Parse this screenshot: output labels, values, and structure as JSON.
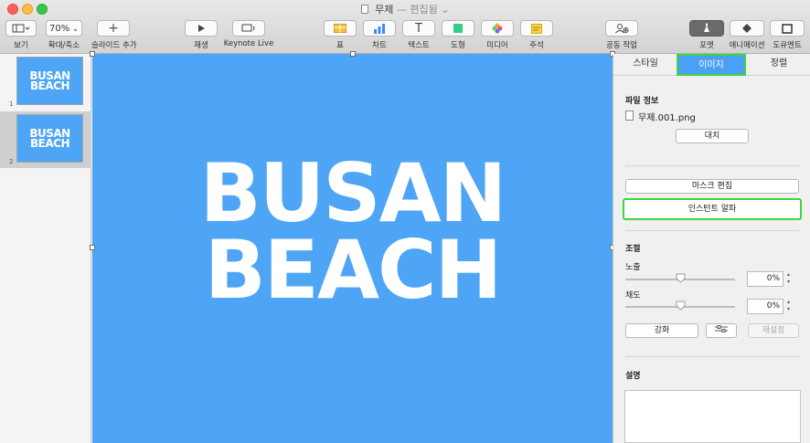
{
  "window": {
    "title": "무제",
    "separator": "—",
    "status": "편집됨"
  },
  "toolbar": {
    "view": {
      "label": "보기"
    },
    "zoom": {
      "value": "70%",
      "label": "확대/축소"
    },
    "add_slide": {
      "label": "슬라이드 추가"
    },
    "play": {
      "label": "재생"
    },
    "keynote_live": {
      "label": "Keynote Live"
    },
    "table": {
      "label": "표"
    },
    "chart": {
      "label": "차트"
    },
    "text": {
      "label": "텍스트"
    },
    "shape": {
      "label": "도형"
    },
    "media": {
      "label": "미디어"
    },
    "comment": {
      "label": "주석"
    },
    "collaborate": {
      "label": "공동 작업"
    },
    "format": {
      "label": "포맷"
    },
    "animate": {
      "label": "애니메이션"
    },
    "document": {
      "label": "도큐멘트"
    }
  },
  "navigator": {
    "slides": [
      {
        "number": "1",
        "line1": "BUSAN",
        "line2": "BEACH"
      },
      {
        "number": "2",
        "line1": "BUSAN",
        "line2": "BEACH"
      }
    ]
  },
  "canvas": {
    "line1": "BUSAN",
    "line2": "BEACH",
    "background": "#4fa5f5"
  },
  "inspector": {
    "tabs": {
      "style": "스타일",
      "image": "이미지",
      "arrange": "정렬"
    },
    "file_info": {
      "title": "파일 정보",
      "file_name": "무제.001.png",
      "replace": "대치"
    },
    "edit_mask": "마스크 편집",
    "instant_alpha": "인스턴트 알파",
    "adjust": {
      "title": "조절",
      "exposure": {
        "label": "노출",
        "value": "0%",
        "level": 0.5
      },
      "saturation": {
        "label": "채도",
        "value": "0%",
        "level": 0.5
      },
      "enhance": "강화",
      "reset": "재설정"
    },
    "description": {
      "title": "설명"
    }
  },
  "colors": {
    "accent": "#4b9ff5",
    "highlight": "#3ed63e"
  }
}
